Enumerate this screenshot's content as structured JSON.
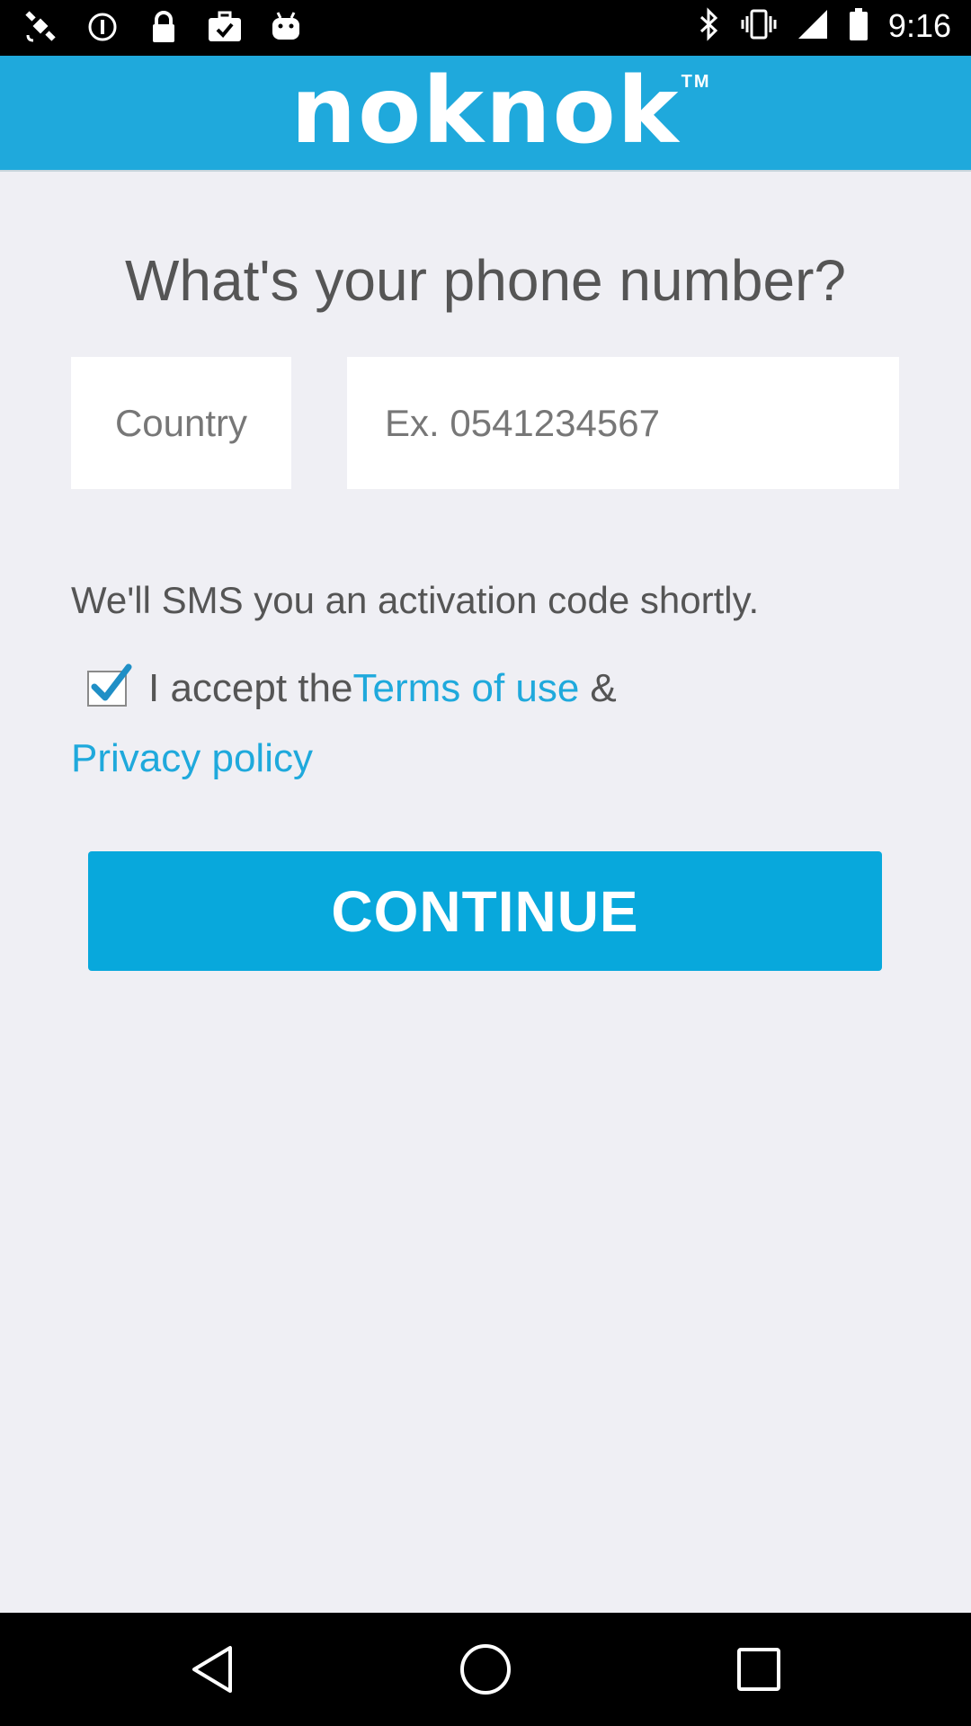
{
  "status_bar": {
    "time": "9:16",
    "left_icons": [
      "satellite-icon",
      "data-saver-icon",
      "lock-icon",
      "briefcase-check-icon",
      "android-icon"
    ],
    "right_icons": [
      "bluetooth-icon",
      "vibrate-icon",
      "signal-icon",
      "battery-icon"
    ]
  },
  "header": {
    "logo_text": "noknok",
    "logo_tm": "TM",
    "background": "#1fa9dc"
  },
  "form": {
    "question": "What's your phone number?",
    "country_label": "Country",
    "phone_placeholder": "Ex. 0541234567",
    "phone_value": "",
    "sms_note": "We'll SMS you an activation code shortly.",
    "terms_checked": true,
    "accept_prefix": "I accept the",
    "terms_link": "Terms of use",
    "ampersand": "&",
    "privacy_link": "Privacy policy",
    "continue_label": "CONTINUE",
    "accent_color": "#08a8dc"
  },
  "nav_bar": {
    "buttons": [
      "back-icon",
      "home-icon",
      "recents-icon"
    ]
  }
}
